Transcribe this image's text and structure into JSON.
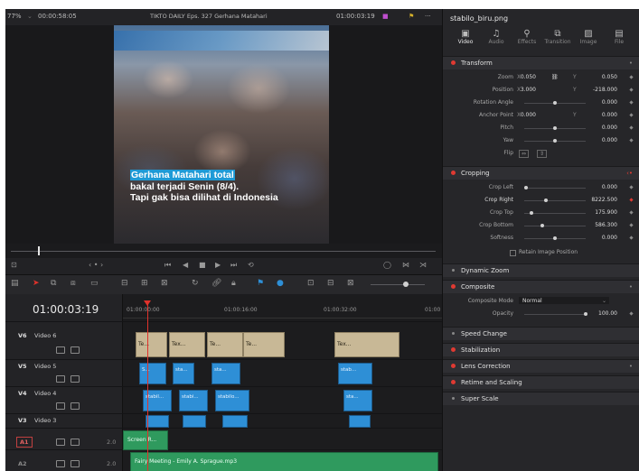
{
  "viewer_header": {
    "zoom": "77%",
    "source_timecode": "00:00:58:05",
    "timeline_name": "TIKTO DAILY Eps. 327 Gerhana Matahari",
    "current_timecode": "01:00:03:19"
  },
  "video": {
    "caption_lines": [
      "Gerhana Matahari total",
      "bakal terjadi Senin (8/4).",
      "Tapi gak bisa dilihat di Indonesia"
    ]
  },
  "timeline": {
    "timecode": "01:00:03:19",
    "ruler": [
      "01:00:00:00",
      "01:00:16:00",
      "01:00:32:00",
      "01:00"
    ],
    "tracks": [
      {
        "id": "V6",
        "name": "Video 6"
      },
      {
        "id": "V5",
        "name": "Video 5"
      },
      {
        "id": "V4",
        "name": "Video 4"
      },
      {
        "id": "V3",
        "name": "Video 3"
      },
      {
        "id": "A1",
        "name": "",
        "level": "2.0"
      },
      {
        "id": "A2",
        "name": "",
        "level": "2.0"
      }
    ],
    "clips_tan": [
      "Te...",
      "Tex...",
      "Te...",
      "Te...",
      "Tex..."
    ],
    "clips_blue": [
      "S...",
      "sta...",
      "sta...",
      "stab...",
      "stabil...",
      "stabi...",
      "stabilo...",
      "sta..."
    ],
    "audio_clips": [
      "Screen R...",
      "Fairy Meeting - Emily A. Sprague.mp3"
    ]
  },
  "inspector": {
    "title": "stabilo_biru.png",
    "tabs": [
      {
        "label": "Video",
        "icon": "film-icon"
      },
      {
        "label": "Audio",
        "icon": "note-icon"
      },
      {
        "label": "Effects",
        "icon": "wand-icon"
      },
      {
        "label": "Transition",
        "icon": "transition-icon"
      },
      {
        "label": "Image",
        "icon": "image-icon"
      },
      {
        "label": "File",
        "icon": "file-icon"
      }
    ],
    "transform": {
      "label": "Transform",
      "rows": [
        {
          "label": "Zoom",
          "axis1": "X",
          "value1": "0.050",
          "axis2": "Y",
          "value2": "0.050"
        },
        {
          "label": "Position",
          "axis1": "X",
          "value1": "3.000",
          "axis2": "Y",
          "value2": "-218.000"
        },
        {
          "label": "Rotation Angle",
          "value": "0.000"
        },
        {
          "label": "Anchor Point",
          "axis1": "X",
          "value1": "0.000",
          "axis2": "Y",
          "value2": "0.000"
        },
        {
          "label": "Pitch",
          "value": "0.000"
        },
        {
          "label": "Yaw",
          "value": "0.000"
        },
        {
          "label": "Flip",
          "value": ""
        }
      ]
    },
    "cropping": {
      "label": "Cropping",
      "rows": [
        {
          "label": "Crop Left",
          "value": "0.000"
        },
        {
          "label": "Crop Right",
          "value": "8222.500"
        },
        {
          "label": "Crop Top",
          "value": "175.900"
        },
        {
          "label": "Crop Bottom",
          "value": "586.300"
        },
        {
          "label": "Softness",
          "value": "0.000"
        }
      ],
      "retain": "Retain Image Position"
    },
    "dynamic_zoom": "Dynamic Zoom",
    "composite": {
      "label": "Composite",
      "mode_label": "Composite Mode",
      "mode_value": "Normal",
      "opacity_label": "Opacity",
      "opacity_value": "100.00"
    },
    "speed_change": "Speed Change",
    "stabilization": "Stabilization",
    "lens_correction": "Lens Correction",
    "retime_scaling": "Retime and Scaling",
    "super_scale": "Super Scale"
  }
}
